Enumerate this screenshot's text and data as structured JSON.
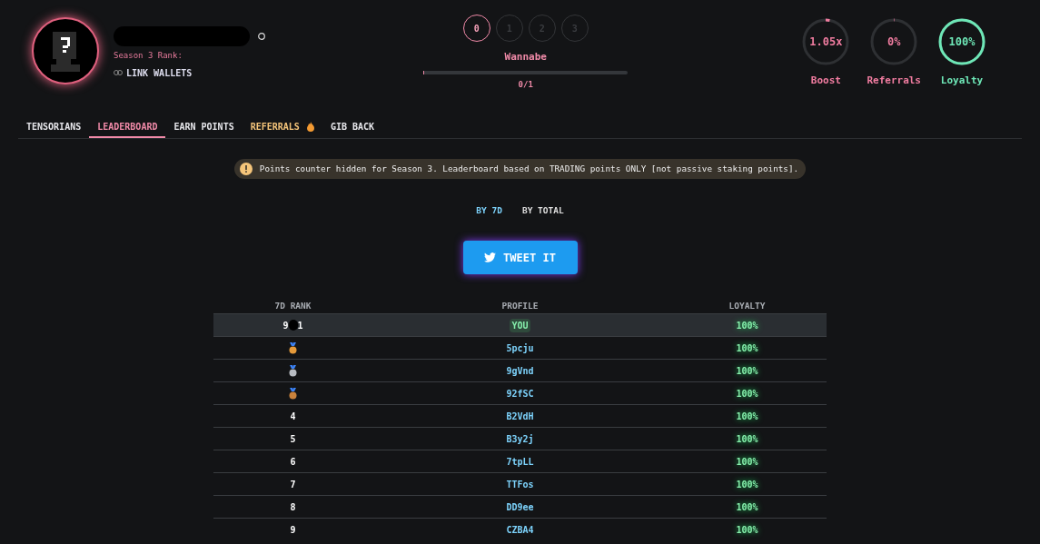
{
  "profile": {
    "rank_label": "Season 3 Rank:",
    "link_wallets": "LINK WALLETS"
  },
  "levels": [
    {
      "label": "0",
      "selected": true
    },
    {
      "label": "1",
      "selected": false
    },
    {
      "label": "2",
      "selected": false
    },
    {
      "label": "3",
      "selected": false
    }
  ],
  "level_name": "Wannabe",
  "progress": {
    "level": 0,
    "reading": "0/1"
  },
  "stats": [
    {
      "value": "1.05x",
      "label": "Boost",
      "level": 0.03,
      "color": "#f07ca0"
    },
    {
      "value": "0%",
      "label": "Referrals",
      "level": 0,
      "color": "#f07ca0"
    },
    {
      "value": "100%",
      "label": "Loyalty",
      "level": 1,
      "color": "#6ee7b7"
    }
  ],
  "tabs": [
    {
      "label": "TENSORIANS",
      "selected": false,
      "kind": "plain"
    },
    {
      "label": "LEADERBOARD",
      "selected": true,
      "kind": "plain"
    },
    {
      "label": "EARN POINTS",
      "selected": false,
      "kind": "plain"
    },
    {
      "label": "REFERRALS",
      "selected": false,
      "kind": "fire"
    },
    {
      "label": "GIB BACK",
      "selected": false,
      "kind": "plain"
    }
  ],
  "notice": "Points counter hidden for Season 3. Leaderboard based on TRADING points ONLY [not passive staking points].",
  "toggle": [
    {
      "label": "BY 7D",
      "selected": true
    },
    {
      "label": "BY TOTAL",
      "selected": false
    }
  ],
  "tweet_button": "TWEET IT",
  "table": {
    "columns": [
      "7D RANK",
      "PROFILE",
      "LOYALTY"
    ],
    "rows": [
      {
        "kind": "you",
        "rank": "9",
        "rank_end": "1",
        "profile": "YOU",
        "loyalty": "100%"
      },
      {
        "kind": "medal",
        "color": "#e59a3a",
        "profile": "5pcju",
        "loyalty": "100%"
      },
      {
        "kind": "medal",
        "color": "#b8bcc2",
        "profile": "9gVnd",
        "loyalty": "100%"
      },
      {
        "kind": "medal",
        "color": "#c9823c",
        "profile": "92fSC",
        "loyalty": "100%"
      },
      {
        "kind": "number",
        "rank": "4",
        "profile": "B2VdH",
        "loyalty": "100%"
      },
      {
        "kind": "number",
        "rank": "5",
        "profile": "B3y2j",
        "loyalty": "100%"
      },
      {
        "kind": "number",
        "rank": "6",
        "profile": "7tpLL",
        "loyalty": "100%"
      },
      {
        "kind": "number",
        "rank": "7",
        "profile": "TTFos",
        "loyalty": "100%"
      },
      {
        "kind": "number",
        "rank": "8",
        "profile": "DD9ee",
        "loyalty": "100%"
      },
      {
        "kind": "number",
        "rank": "9",
        "profile": "CZBA4",
        "loyalty": "100%"
      }
    ]
  }
}
